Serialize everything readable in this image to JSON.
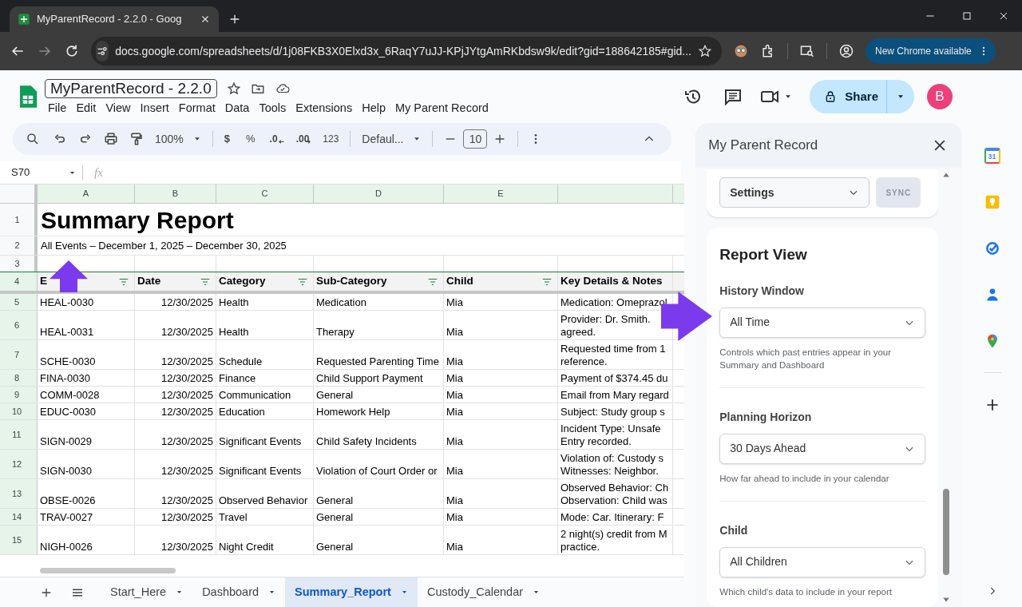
{
  "browser": {
    "tab_title": "MyParentRecord - 2.2.0 - Goog",
    "url": "docs.google.com/spreadsheets/d/1j08FKB3X0Elxd3x_6RaqY7uJJ-KPjJYtgAmRKbdsw9k/edit?gid=188642185#gid...",
    "update_button": "New Chrome available"
  },
  "sheets": {
    "doc_title": "MyParentRecord - 2.2.0",
    "menu": [
      "File",
      "Edit",
      "View",
      "Insert",
      "Format",
      "Data",
      "Tools",
      "Extensions",
      "Help",
      "My Parent Record"
    ],
    "share": "Share",
    "avatar": "B",
    "toolbar": {
      "zoom": "100%",
      "currency": "$",
      "percent": "%",
      "decrease_decimals": ".0",
      "increase_decimals": ".00",
      "number_format": "123",
      "font": "Defaul...",
      "font_size": "10"
    },
    "name_box": "S70",
    "fx": "fx",
    "columns": [
      "A",
      "B",
      "C",
      "D",
      "E",
      ""
    ],
    "title_row": {
      "n": "1",
      "text": "Summary Report"
    },
    "subtitle_row": {
      "n": "2",
      "text": "All Events – December 1, 2025 – December 30, 2025"
    },
    "blank_row": {
      "n": "3"
    },
    "header_row": {
      "n": "4",
      "cells": [
        {
          "text": "E",
          "filter": true
        },
        {
          "text": "Date",
          "filter": true
        },
        {
          "text": "Category",
          "filter": true
        },
        {
          "text": "Sub-Category",
          "filter": true
        },
        {
          "text": "Child",
          "filter": true
        },
        {
          "text": "Key Details & Notes",
          "filter": false
        }
      ]
    },
    "rows": [
      {
        "n": "5",
        "cells": [
          "HEAL-0030",
          "12/30/2025",
          "Health",
          "Medication",
          "Mia",
          "Medication: Omeprazol"
        ]
      },
      {
        "n": "6",
        "cells": [
          "HEAL-0031",
          "12/30/2025",
          "Health",
          "Therapy",
          "Mia",
          "Provider: Dr. Smith.\nagreed."
        ]
      },
      {
        "n": "7",
        "cells": [
          "SCHE-0030",
          "12/30/2025",
          "Schedule",
          "Requested Parenting Time",
          "Mia",
          "Requested time from 1\nreference."
        ]
      },
      {
        "n": "8",
        "cells": [
          "FINA-0030",
          "12/30/2025",
          "Finance",
          "Child Support Payment",
          "Mia",
          "Payment of $374.45 du"
        ]
      },
      {
        "n": "9",
        "cells": [
          "COMM-0028",
          "12/30/2025",
          "Communication",
          "General",
          "Mia",
          "Email from Mary regard"
        ]
      },
      {
        "n": "10",
        "cells": [
          "EDUC-0030",
          "12/30/2025",
          "Education",
          "Homework Help",
          "Mia",
          "Subject: Study group s"
        ]
      },
      {
        "n": "11",
        "cells": [
          "SIGN-0029",
          "12/30/2025",
          "Significant Events",
          "Child Safety Incidents",
          "Mia",
          "Incident Type: Unsafe\nEntry recorded."
        ]
      },
      {
        "n": "12",
        "cells": [
          "SIGN-0030",
          "12/30/2025",
          "Significant Events",
          "Violation of Court Order or",
          "Mia",
          "Violation of: Custody s\nWitnesses: Neighbor."
        ]
      },
      {
        "n": "13",
        "cells": [
          "OBSE-0026",
          "12/30/2025",
          "Observed Behavior",
          "General",
          "Mia",
          "Observed Behavior: Ch\nObservation: Child was"
        ]
      },
      {
        "n": "14",
        "cells": [
          "TRAV-0027",
          "12/30/2025",
          "Travel",
          "General",
          "Mia",
          "Mode: Car. Itinerary: F"
        ]
      },
      {
        "n": "15",
        "cells": [
          "NIGH-0026",
          "12/30/2025",
          "Night Credit",
          "General",
          "Mia",
          "2 night(s) credit from M\npractice."
        ]
      }
    ],
    "sheet_tabs": [
      {
        "label": "Start_Here",
        "selected": false
      },
      {
        "label": "Dashboard",
        "selected": false
      },
      {
        "label": "Summary_Report",
        "selected": true
      },
      {
        "label": "Custody_Calendar",
        "selected": false
      }
    ]
  },
  "side_panel": {
    "title": "My Parent Record",
    "menu_select": "Settings",
    "sync_button": {
      "label": "SYNC",
      "disabled": true
    },
    "section_title": "Report View",
    "fields": [
      {
        "label": "History Window",
        "value": "All Time",
        "help": "Controls which past entries appear in your Summary and Dashboard"
      },
      {
        "label": "Planning Horizon",
        "value": "30 Days Ahead",
        "help": "How far ahead to include in your calendar"
      },
      {
        "label": "Child",
        "value": "All Children",
        "help": "Which child's data to include in your report"
      }
    ]
  },
  "side_rail": [
    {
      "kind": "calendar",
      "text": "31"
    },
    {
      "kind": "keep"
    },
    {
      "kind": "tasks"
    },
    {
      "kind": "contacts"
    },
    {
      "kind": "maps"
    }
  ]
}
